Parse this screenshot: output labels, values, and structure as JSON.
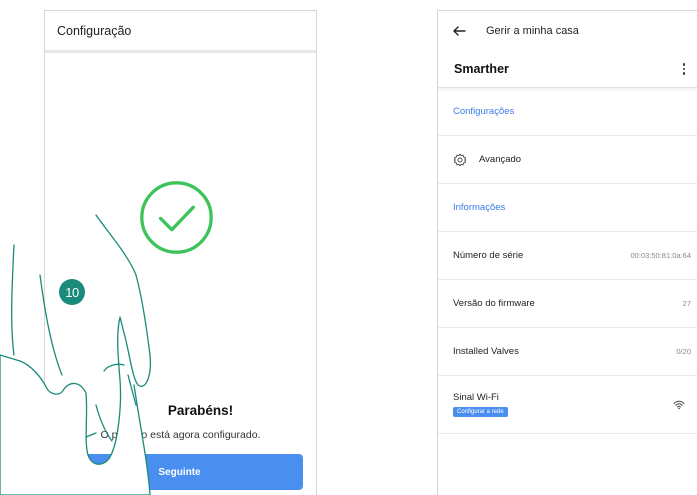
{
  "left_screen": {
    "header_title": "Configuração",
    "success_title": "Parabéns!",
    "success_subtitle": "O produto está agora configurado.",
    "next_button": "Seguinte",
    "step_badge": "10",
    "check_icon": "check-circle-icon",
    "accent_color": "#4a8ff0",
    "success_color": "#3cc35a"
  },
  "right_screen": {
    "top_title": "Gerir a minha casa",
    "device_name": "Smarther",
    "settings_section": "Configurações",
    "advanced_label": "Avançado",
    "info_section": "Informações",
    "serial_label": "Número de série",
    "serial_value": "00:03:50:81:0a:64",
    "firmware_label": "Versão do firmware",
    "firmware_value": "27",
    "valves_label": "Installed Valves",
    "valves_value": "0/20",
    "wifi_label": "Sinal Wi-Fi",
    "configure_network_button": "Configurar a rede",
    "section_color": "#3a7be6"
  }
}
